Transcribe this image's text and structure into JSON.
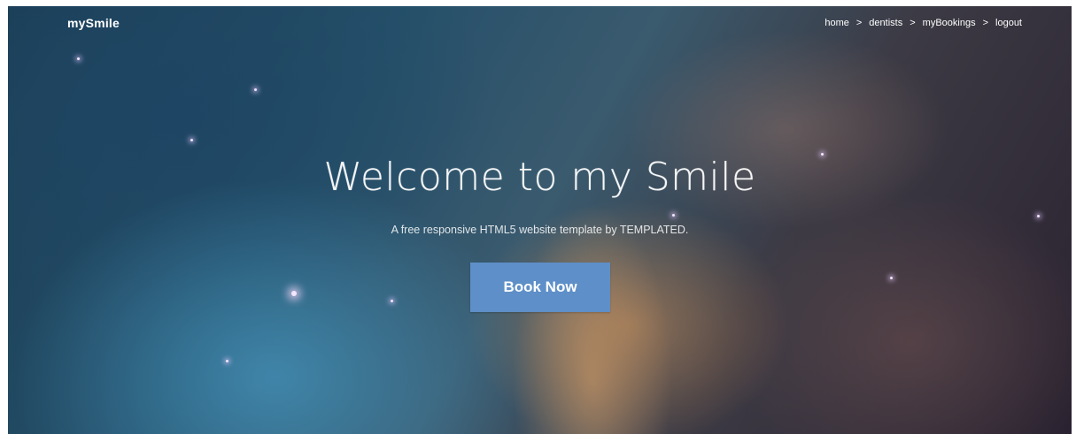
{
  "header": {
    "logo": "mySmile",
    "nav": [
      {
        "label": "home"
      },
      {
        "label": "dentists"
      },
      {
        "label": "myBookings"
      },
      {
        "label": "logout"
      }
    ],
    "separator": ">"
  },
  "hero": {
    "title": "Welcome to my Smile",
    "subtitle": "A free responsive HTML5 website template by TEMPLATED.",
    "cta_label": "Book Now",
    "background": "nebula-space-image"
  },
  "colors": {
    "button_bg": "#5e8fc8",
    "text": "#ffffff"
  }
}
